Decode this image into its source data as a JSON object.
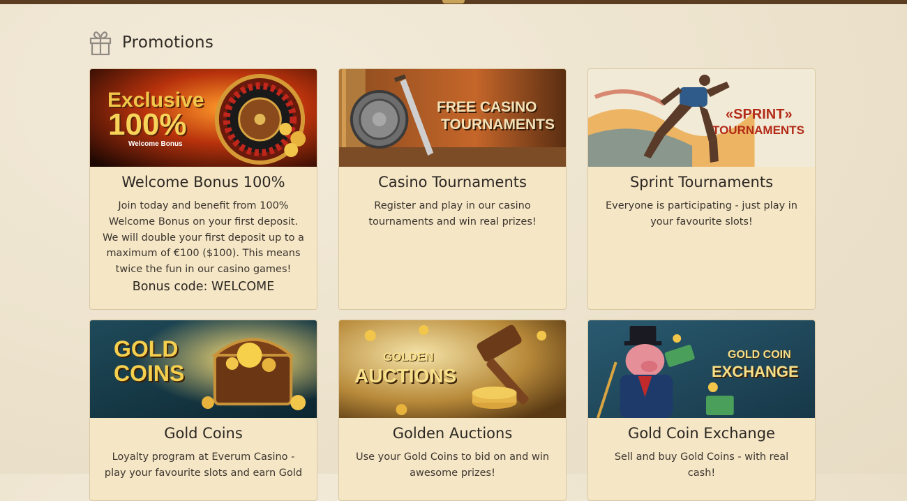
{
  "page": {
    "section_title": "Promotions"
  },
  "promotions": [
    {
      "banner_line1": "Exclusive",
      "banner_line2": "100%",
      "banner_line3": "Welcome Bonus",
      "title": "Welcome Bonus 100%",
      "description": "Join today and benefit from 100% Welcome Bonus on your first deposit. We will double your first deposit up to a maximum of €100 ($100). This means twice the fun in our casino games!",
      "code": "Bonus code: WELCOME"
    },
    {
      "banner_line1": "FREE CASINO",
      "banner_line2": "TOURNAMENTS",
      "title": "Casino Tournaments",
      "description": "Register and play in our casino tournaments and win real prizes!"
    },
    {
      "banner_line1": "«SPRINT»",
      "banner_line2": "TOURNAMENTS",
      "title": "Sprint Tournaments",
      "description": "Everyone is participating - just play in your favourite slots!"
    },
    {
      "banner_line1": "GOLD",
      "banner_line2": "COINS",
      "title": "Gold Coins",
      "description": "Loyalty program at Everum Casino - play your favourite slots and earn Gold"
    },
    {
      "banner_line1": "GOLDEN",
      "banner_line2": "AUCTIONS",
      "title": "Golden Auctions",
      "description": "Use your Gold Coins to bid on and win awesome prizes!"
    },
    {
      "banner_line1": "GOLD COIN",
      "banner_line2": "EXCHANGE",
      "title": "Gold Coin Exchange",
      "description": "Sell and buy Gold Coins - with real cash!"
    }
  ],
  "icons": {
    "section_icon": "gift-icon"
  },
  "colors": {
    "topbar": "#5b3d22",
    "card_bg": "#f5e6c6",
    "banner_gold": "#f2c64a"
  }
}
